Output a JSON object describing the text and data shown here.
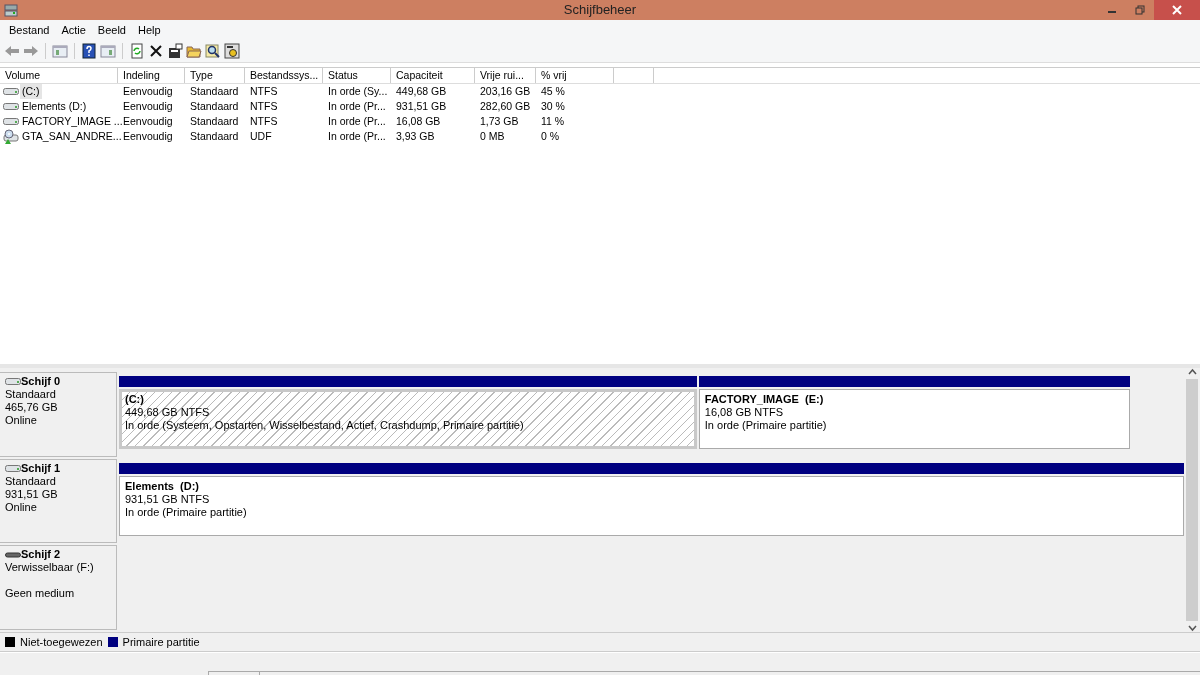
{
  "window": {
    "title": "Schijfbeheer"
  },
  "menu": [
    "Bestand",
    "Actie",
    "Beeld",
    "Help"
  ],
  "volumes": {
    "columns": [
      "Volume",
      "Indeling",
      "Type",
      "Bestandssys...",
      "Status",
      "Capaciteit",
      "Vrije rui...",
      "% vrij"
    ],
    "rows": [
      {
        "kind": "disk",
        "selected": true,
        "cells": [
          "(C:)",
          "Eenvoudig",
          "Standaard",
          "NTFS",
          "In orde (Sy...",
          "449,68 GB",
          "203,16 GB",
          "45 %"
        ]
      },
      {
        "kind": "disk",
        "selected": false,
        "cells": [
          "Elements (D:)",
          "Eenvoudig",
          "Standaard",
          "NTFS",
          "In orde (Pr...",
          "931,51 GB",
          "282,60 GB",
          "30 %"
        ]
      },
      {
        "kind": "disk",
        "selected": false,
        "cells": [
          "FACTORY_IMAGE ...",
          "Eenvoudig",
          "Standaard",
          "NTFS",
          "In orde (Pr...",
          "16,08 GB",
          "1,73 GB",
          "11 %"
        ]
      },
      {
        "kind": "optical",
        "selected": false,
        "cells": [
          "GTA_SAN_ANDRE...",
          "Eenvoudig",
          "Standaard",
          "UDF",
          "In orde (Pr...",
          "3,93 GB",
          "0 MB",
          "0 %"
        ]
      }
    ]
  },
  "disks": [
    {
      "kind": "fixed",
      "name": "Schijf 0",
      "type": "Standaard",
      "size": "465,76 GB",
      "status": "Online",
      "partitions": [
        {
          "label": "(C:)",
          "size": "449,68 GB NTFS",
          "status": "In orde (Systeem, Opstarten, Wisselbestand, Actief, Crashdump, Primaire partitie)",
          "selected": true
        },
        {
          "label": "FACTORY_IMAGE  (E:)",
          "size": "16,08 GB NTFS",
          "status": "In orde (Primaire partitie)",
          "selected": false
        }
      ]
    },
    {
      "kind": "fixed",
      "name": "Schijf 1",
      "type": "Standaard",
      "size": "931,51 GB",
      "status": "Online",
      "partitions": [
        {
          "label": "Elements  (D:)",
          "size": "931,51 GB NTFS",
          "status": "In orde (Primaire partitie)",
          "selected": false
        }
      ]
    },
    {
      "kind": "removable",
      "name": "Schijf 2",
      "type": "Verwisselbaar (F:)",
      "status": "Geen medium"
    }
  ],
  "legend": [
    {
      "label": "Niet-toegewezen",
      "color": "#000000"
    },
    {
      "label": "Primaire partitie",
      "color": "#000080"
    }
  ]
}
